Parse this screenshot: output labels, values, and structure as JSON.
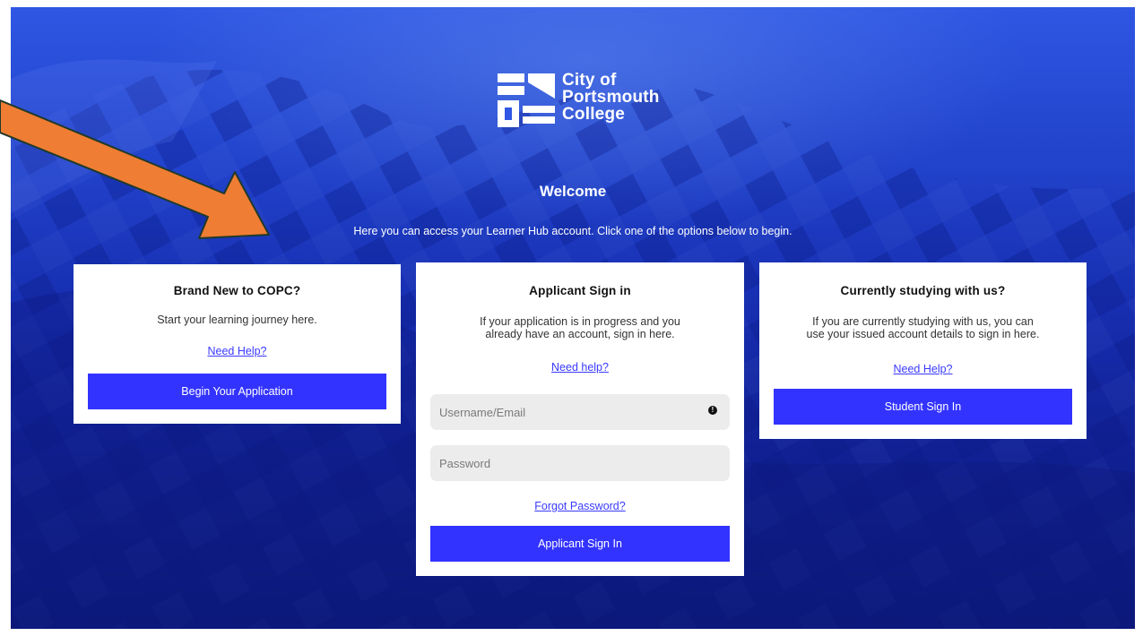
{
  "brand": {
    "name_line1": "City of",
    "name_line2": "Portsmouth",
    "name_line3": "College"
  },
  "welcome": {
    "title": "Welcome",
    "intro": "Here you can access your Learner Hub account. Click one of the options below to begin."
  },
  "new_card": {
    "title": "Brand New to COPC?",
    "description": "Start your learning journey here.",
    "help": "Need Help?",
    "button": "Begin Your Application"
  },
  "applicant_card": {
    "title": "Applicant Sign in",
    "description_line1": "If your application is in progress and you",
    "description_line2": "already have an account, sign in here.",
    "help": "Need help?",
    "username_placeholder": "Username/Email",
    "password_placeholder": "Password",
    "forgot": "Forgot Password?",
    "button": "Applicant Sign In"
  },
  "student_card": {
    "title": "Currently studying with us?",
    "description_line1": "If you are currently studying with us, you can",
    "description_line2": "use your issued account details to sign in here.",
    "help": "Need Help?",
    "button": "Student Sign In"
  },
  "colors": {
    "accent": "#3333ff",
    "annotation_arrow": "#ef7d33",
    "hero": "#2448d8"
  },
  "icons": {
    "info": "info-circle-icon",
    "logo": "college-logo-icon"
  }
}
